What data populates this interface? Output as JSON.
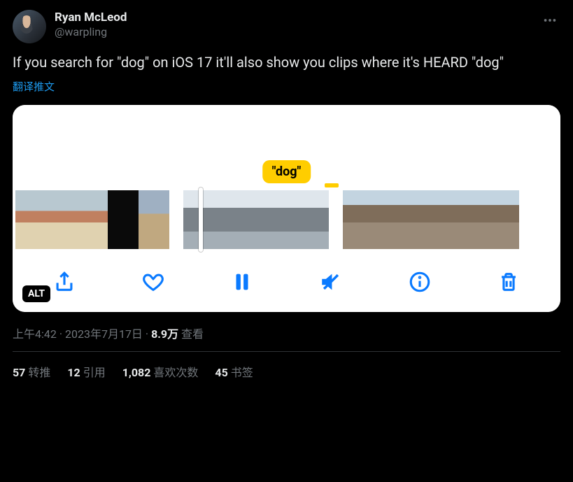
{
  "author": {
    "display_name": "Ryan McLeod",
    "handle": "@warpling"
  },
  "body": "If you search for \"dog\" on iOS 17 it'll also show you clips where it's HEARD \"dog\"",
  "translate_label": "翻译推文",
  "media": {
    "tooltip": "\"dog\"",
    "alt_badge": "ALT"
  },
  "meta": {
    "time": "上午4:42",
    "date": "2023年7月17日",
    "views_count": "8.9万",
    "views_label": "查看"
  },
  "stats": {
    "retweets_count": "57",
    "retweets_label": "转推",
    "quotes_count": "12",
    "quotes_label": "引用",
    "likes_count": "1,082",
    "likes_label": "喜欢次数",
    "bookmarks_count": "45",
    "bookmarks_label": "书签"
  }
}
